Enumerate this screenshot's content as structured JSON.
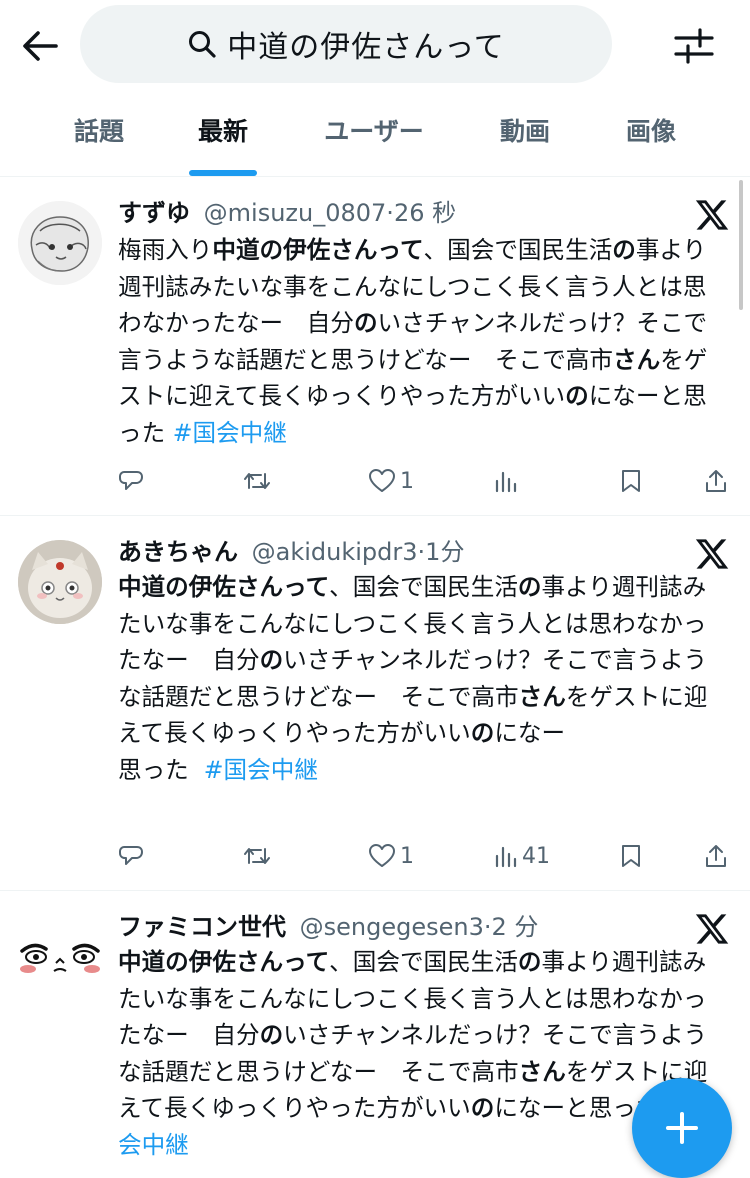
{
  "header": {
    "search_query": "中道の伊佐さんって"
  },
  "tabs": [
    {
      "label": "話題",
      "active": false
    },
    {
      "label": "最新",
      "active": true
    },
    {
      "label": "ユーザー",
      "active": false
    },
    {
      "label": "動画",
      "active": false
    },
    {
      "label": "画像",
      "active": false
    }
  ],
  "tweets": [
    {
      "name": "すずゆ",
      "handle": "@misuzu_0807",
      "time": "26 秒",
      "hashtag": "#国会中継",
      "replies": "",
      "retweets": "",
      "likes": "1",
      "views": ""
    },
    {
      "name": "あきちゃん",
      "handle": "@akidukipdr3",
      "time": "1分",
      "hashtag": "#国会中継",
      "replies": "",
      "retweets": "",
      "likes": "1",
      "views": "41"
    },
    {
      "name": "ファミコン世代",
      "handle": "@sengegesen3",
      "time": "2 分",
      "hashtag": "#国会中継"
    }
  ],
  "colors": {
    "accent": "#1d9bf0",
    "text": "#0f1419",
    "muted": "#536471"
  },
  "icons": {
    "back": "arrow-left-icon",
    "search": "search-icon",
    "filter": "sliders-icon",
    "platform": "x-logo-icon",
    "reply": "reply-icon",
    "retweet": "retweet-icon",
    "like": "heart-icon",
    "views": "views-icon",
    "bookmark": "bookmark-icon",
    "share": "share-icon",
    "compose": "plus-icon"
  }
}
